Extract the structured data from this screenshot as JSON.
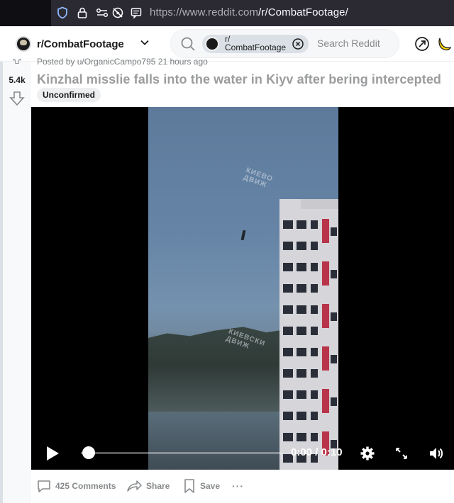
{
  "browser": {
    "url_host": "https://www.reddit.com",
    "url_path": "/r/CombatFootage/"
  },
  "header": {
    "subreddit": "r/CombatFootage",
    "search_chip_line1": "r/",
    "search_chip_line2": "CombatFootage",
    "search_placeholder": "Search Reddit"
  },
  "post": {
    "posted_by": "Posted by u/OrganicCampo795 21 hours ago",
    "vote_count": "5.4k",
    "title": "Kinzhal misslie falls into the water in Kiyv after bering intercepted",
    "flair": "Unconfirmed",
    "watermark_1": "КИЕВО\nДВИЖ",
    "watermark_2": "КИЕВСКИ\nДВИЖ"
  },
  "video": {
    "time_display": "0:00 / 0:10",
    "progress": 0.0
  },
  "actions": {
    "comments": "425 Comments",
    "share": "Share",
    "save": "Save",
    "more": "···"
  },
  "colors": {
    "reddit_orange": "#ff4500",
    "browser_bar": "#1c1b22",
    "muted_text": "#878a8c"
  }
}
